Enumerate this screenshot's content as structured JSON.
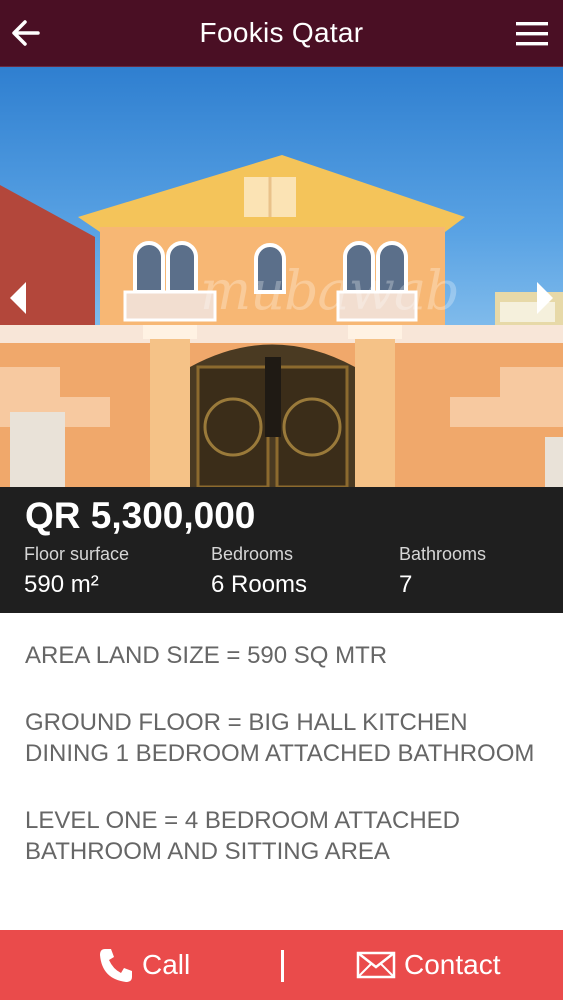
{
  "header": {
    "title": "Fookis Qatar",
    "back_icon": "arrow-left-icon",
    "menu_icon": "hamburger-menu-icon",
    "background": "#4a0f24"
  },
  "gallery": {
    "watermark": "mubawab",
    "prev_icon": "chevron-left-icon",
    "next_icon": "chevron-right-icon"
  },
  "listing": {
    "price": "QR 5,300,000",
    "stats": [
      {
        "label": "Floor surface",
        "value": "590 m²"
      },
      {
        "label": "Bedrooms",
        "value": "6 Rooms"
      },
      {
        "label": "Bathrooms",
        "value": "7"
      }
    ]
  },
  "description": [
    "AREA LAND SIZE = 590 SQ MTR",
    "GROUND FLOOR = BIG HALL KITCHEN DINING 1 BEDROOM ATTACHED BATHROOM",
    "LEVEL ONE = 4 BEDROOM ATTACHED BATHROOM AND SITTING AREA"
  ],
  "actions": {
    "call_label": "Call",
    "contact_label": "Contact",
    "call_icon": "phone-icon",
    "contact_icon": "envelope-icon",
    "background": "#ea4b4b"
  }
}
